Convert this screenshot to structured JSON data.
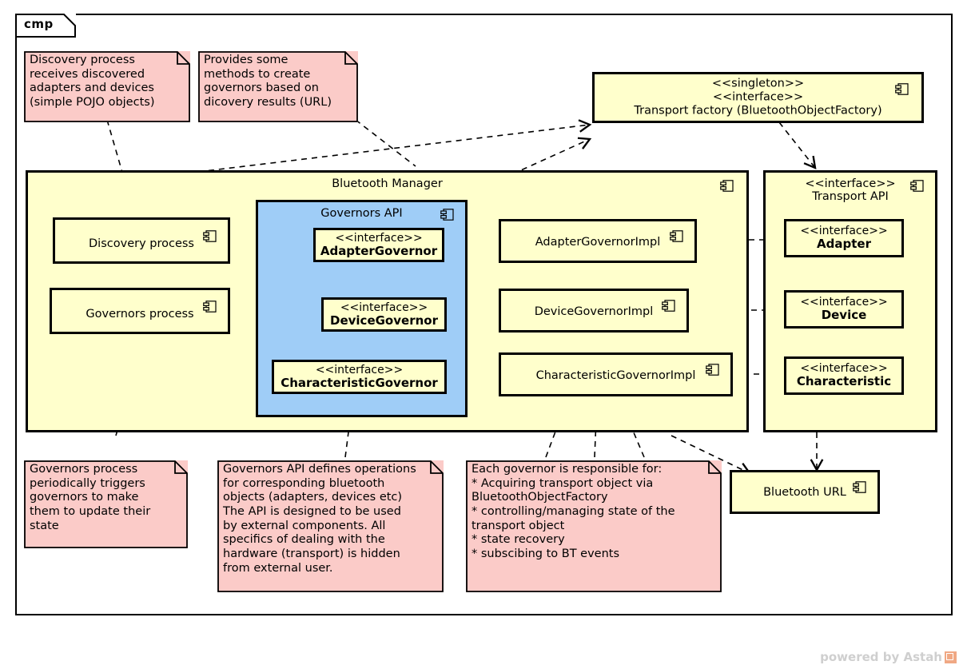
{
  "frame": {
    "label": "cmp"
  },
  "notes": [
    {
      "id": "note-discovery",
      "text": "Discovery process\nreceives discovered\nadapters and devices\n(simple POJO objects)"
    },
    {
      "id": "note-factory",
      "text": "Provides some\nmethods to create\ngovernors based on\ndicovery results (URL)"
    },
    {
      "id": "note-governors-process",
      "text": "Governors process\nperiodically triggers\ngovernors to make\nthem to update their\nstate"
    },
    {
      "id": "note-governors-api",
      "text": "Governors API defines operations\nfor corresponding bluetooth\nobjects (adapters, devices etc)\nThe API is designed to be used\nby external components. All\nspecifics of dealing with the\nhardware (transport) is hidden\nfrom external user."
    },
    {
      "id": "note-each-governor",
      "text": "Each governor is responsible for:\n* Acquiring transport object via\nBluetoothObjectFactory\n* controlling/managing state of the\ntransport object\n* state recovery\n* subscibing to BT events"
    }
  ],
  "transport_factory": {
    "stereotype1": "<<singleton>>",
    "stereotype2": "<<interface>>",
    "name": "Transport factory (BluetoothObjectFactory)"
  },
  "bluetooth_manager": {
    "title": "Bluetooth Manager",
    "components": [
      {
        "id": "discovery-process",
        "label": "Discovery process"
      },
      {
        "id": "governors-process",
        "label": "Governors process"
      },
      {
        "id": "adapter-governor-impl",
        "label": "AdapterGovernorImpl"
      },
      {
        "id": "device-governor-impl",
        "label": "DeviceGovernorImpl"
      },
      {
        "id": "characteristic-governor-impl",
        "label": "CharacteristicGovernorImpl"
      }
    ],
    "governors_api": {
      "title": "Governors API",
      "interfaces": [
        {
          "id": "adapter-governor",
          "stereotype": "<<interface>>",
          "name": "AdapterGovernor"
        },
        {
          "id": "device-governor",
          "stereotype": "<<interface>>",
          "name": "DeviceGovernor"
        },
        {
          "id": "characteristic-governor",
          "stereotype": "<<interface>>",
          "name": "CharacteristicGovernor"
        }
      ]
    }
  },
  "transport_api": {
    "stereotype": "<<interface>>",
    "title": "Transport API",
    "interfaces": [
      {
        "id": "adapter",
        "stereotype": "<<interface>>",
        "name": "Adapter"
      },
      {
        "id": "device",
        "stereotype": "<<interface>>",
        "name": "Device"
      },
      {
        "id": "characteristic",
        "stereotype": "<<interface>>",
        "name": "Characteristic"
      }
    ]
  },
  "bluetooth_url": {
    "label": "Bluetooth URL"
  },
  "watermark": {
    "text": "powered by Astah"
  },
  "colors": {
    "component_fill": "#ffffcc",
    "note_fill": "#fbcbc8",
    "governors_api_fill": "#9fcdf7",
    "stroke": "#000000"
  }
}
